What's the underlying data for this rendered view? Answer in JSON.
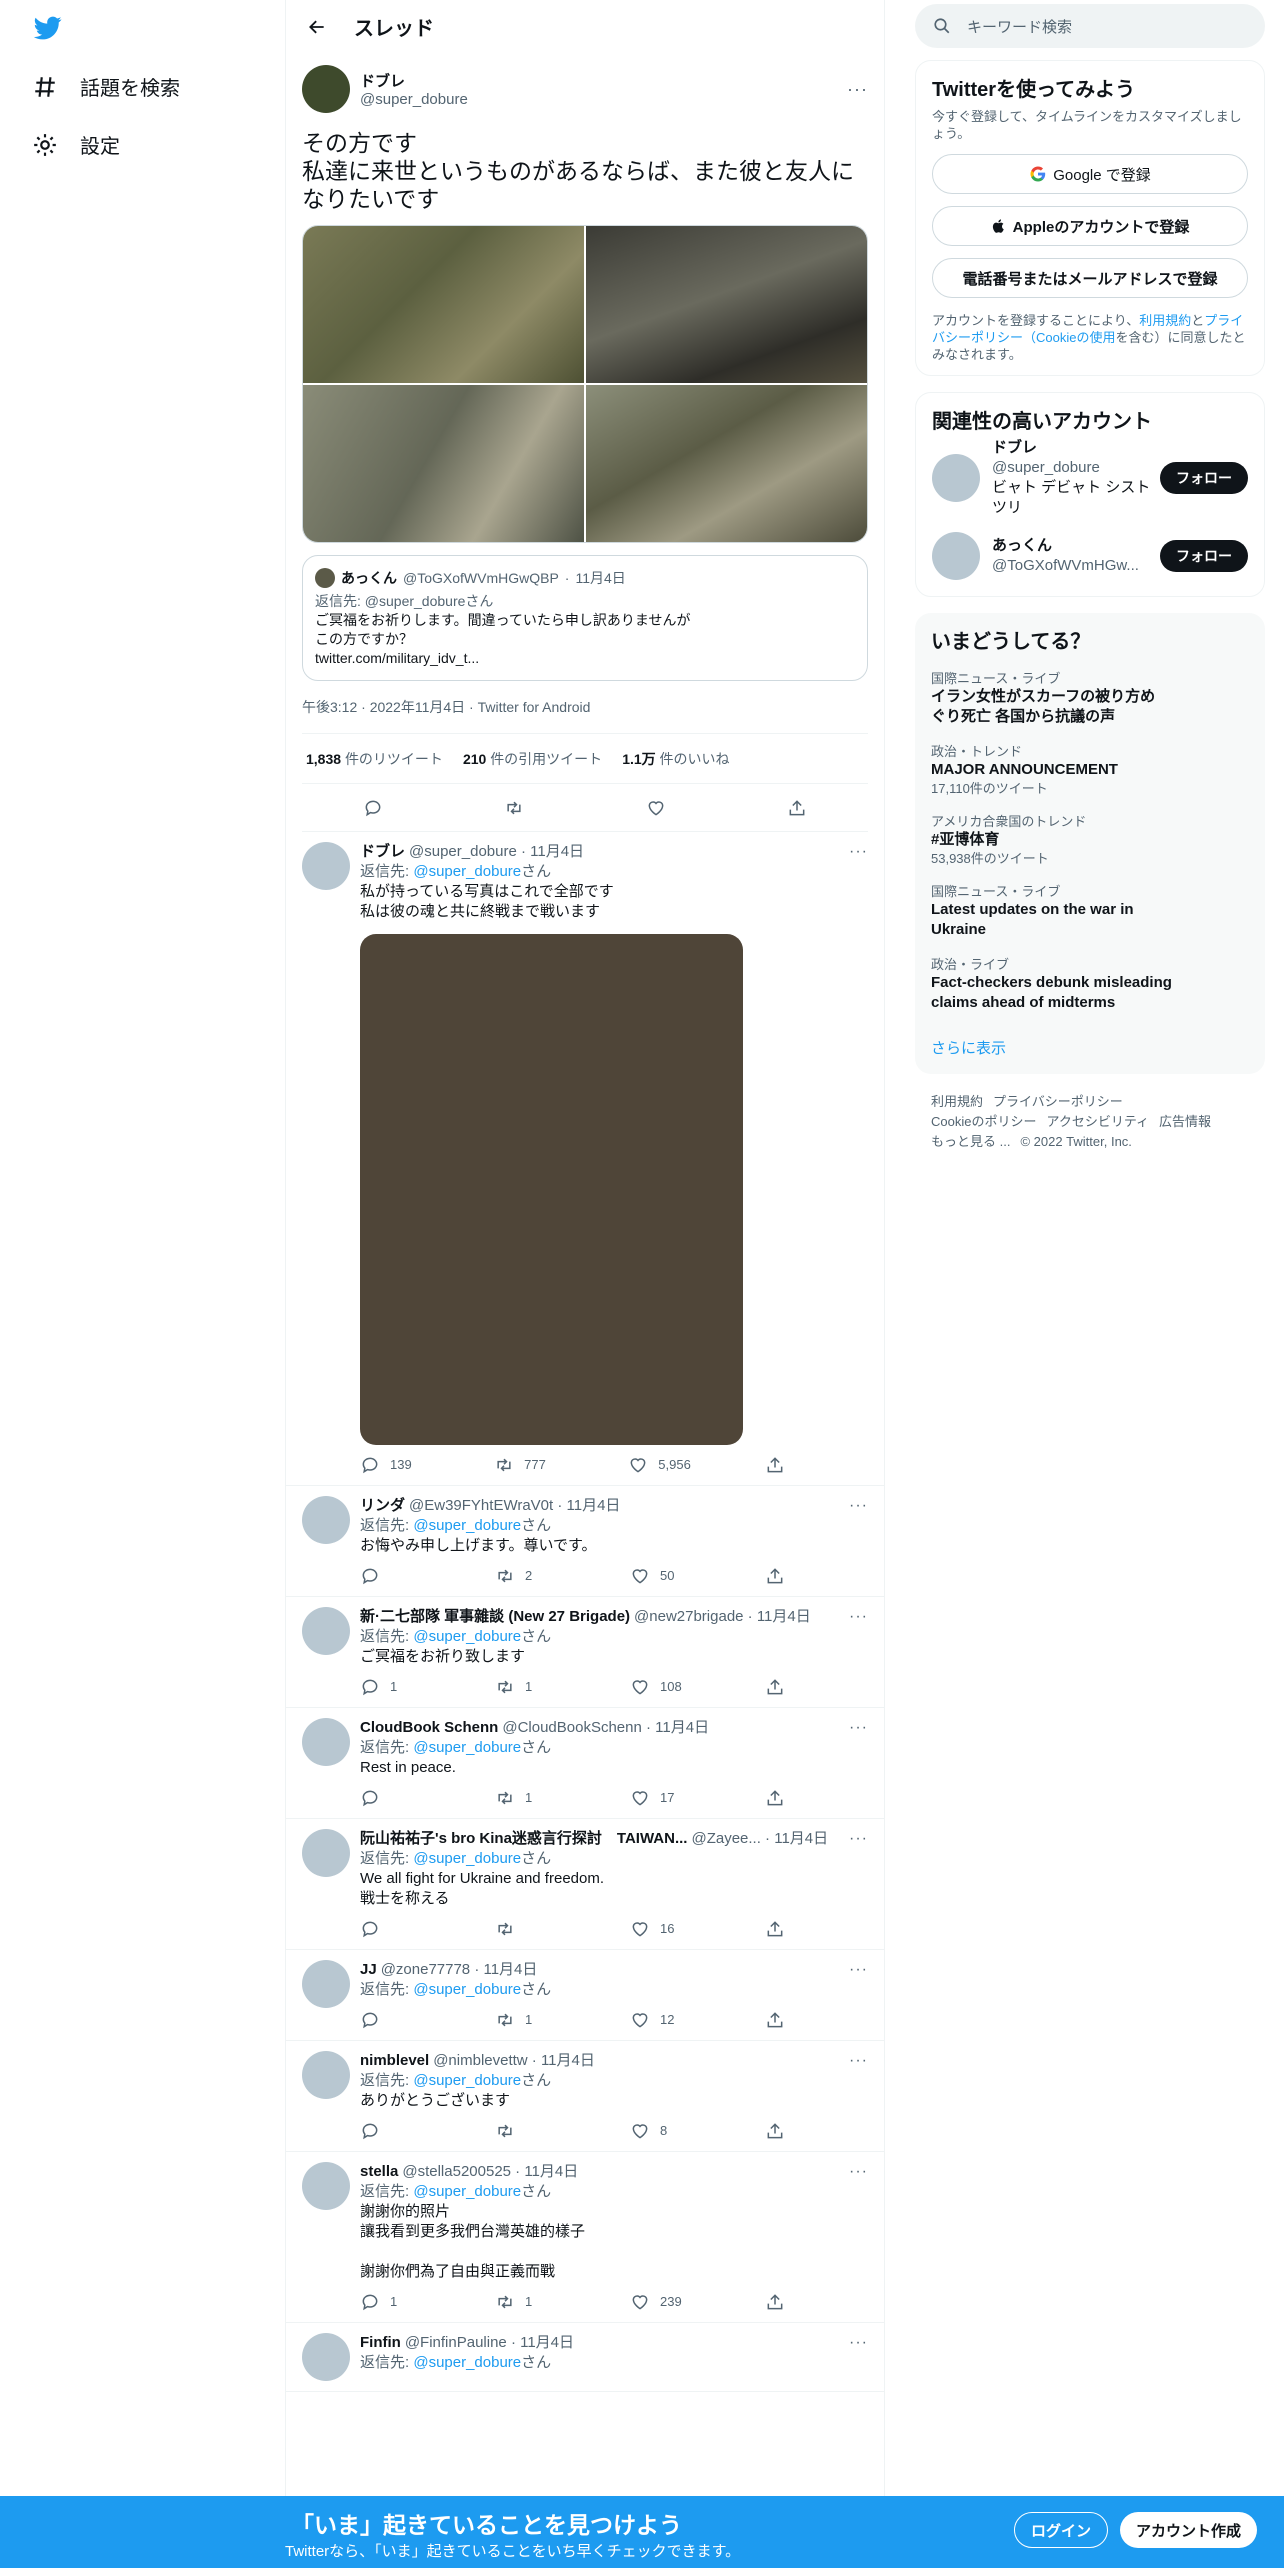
{
  "nav": {
    "explore_label": "話題を検索",
    "settings_label": "設定"
  },
  "header": {
    "title": "スレッド"
  },
  "main_tweet": {
    "name": "ドブレ",
    "handle": "@super_dobure",
    "text": "その方です\n私達に来世というものがあるならば、また彼と友人になりたいです",
    "quote": {
      "name": "あっくん",
      "handle": "@ToGXofWVmHGwQBP",
      "date": "11月4日",
      "reply_prefix": "返信先: @super_dobureさん",
      "text": "ご冥福をお祈りします。間違っていたら申し訳ありませんが\nこの方ですか？\ntwitter.com/military_idv_t..."
    },
    "meta": "午後3:12 · 2022年11月4日 · Twitter for Android",
    "stats": {
      "retweets_count": "1,838",
      "retweets_label": "件のリツイート",
      "quotes_count": "210",
      "quotes_label": "件の引用ツイート",
      "likes_count": "1.1万",
      "likes_label": "件のいいね"
    }
  },
  "replies": [
    {
      "name": "ドブレ",
      "handle": "@super_dobure · 11月4日",
      "reply_to_label": "返信先:",
      "reply_to_handle": "@super_dobure",
      "reply_to_suffix": "さん",
      "text": "私が持っている写真はこれで全部です\n私は彼の魂と共に終戦まで戦います",
      "replies": "139",
      "retweets": "777",
      "likes": "5,956"
    },
    {
      "name": "リンダ",
      "handle": "@Ew39FYhtEWraV0t · 11月4日",
      "reply_to_label": "返信先:",
      "reply_to_handle": "@super_dobure",
      "reply_to_suffix": "さん",
      "text": "お悔やみ申し上げます。尊いです。",
      "replies": "",
      "retweets": "2",
      "likes": "50"
    },
    {
      "name": "新·二七部隊 軍事雜談 (New 27 Brigade)",
      "handle": "@new27brigade · 11月4日",
      "reply_to_label": "返信先:",
      "reply_to_handle": "@super_dobure",
      "reply_to_suffix": "さん",
      "text": "ご冥福をお祈り致します",
      "replies": "1",
      "retweets": "1",
      "likes": "108"
    },
    {
      "name": "CloudBook Schenn",
      "handle": "@CloudBookSchenn · 11月4日",
      "reply_to_label": "返信先:",
      "reply_to_handle": "@super_dobure",
      "reply_to_suffix": "さん",
      "text": "Rest in peace.",
      "replies": "",
      "retweets": "1",
      "likes": "17"
    },
    {
      "name": "阮山祐祐子's bro Kina迷惑言行探討　TAIWAN...",
      "handle": "@Zayee... · 11月4日",
      "reply_to_label": "返信先:",
      "reply_to_handle": "@super_dobure",
      "reply_to_suffix": "さん",
      "text": "We all fight for Ukraine and freedom.\n戦士を称える",
      "replies": "",
      "retweets": "",
      "likes": "16"
    },
    {
      "name": "JJ",
      "handle": "@zone77778 · 11月4日",
      "reply_to_label": "返信先:",
      "reply_to_handle": "@super_dobure",
      "reply_to_suffix": "さん",
      "text": "",
      "replies": "",
      "retweets": "1",
      "likes": "12"
    },
    {
      "name": "nimblevel",
      "handle": "@nimblevettw · 11月4日",
      "reply_to_label": "返信先:",
      "reply_to_handle": "@super_dobure",
      "reply_to_suffix": "さん",
      "text": "ありがとうございます",
      "replies": "",
      "retweets": "",
      "likes": "8"
    },
    {
      "name": "stella",
      "handle": "@stella5200525 · 11月4日",
      "reply_to_label": "返信先:",
      "reply_to_handle": "@super_dobure",
      "reply_to_suffix": "さん",
      "text": "謝謝你的照片\n讓我看到更多我們台灣英雄的樣子\n\n謝謝你們為了自由與正義而戰",
      "replies": "1",
      "retweets": "1",
      "likes": "239"
    },
    {
      "name": "Finfin",
      "handle": "@FinfinPauline · 11月4日",
      "reply_to_label": "返信先:",
      "reply_to_handle": "@super_dobure",
      "reply_to_suffix": "さん",
      "text": "",
      "replies": "",
      "retweets": "",
      "likes": ""
    }
  ],
  "sidebar": {
    "search_placeholder": "キーワード検索",
    "signup": {
      "title": "Twitterを使ってみよう",
      "subtitle": "今すぐ登録して、タイムラインをカスタマイズしましょう。",
      "google_label": "Google で登録",
      "apple_label": "Appleのアカウントで登録",
      "phone_label": "電話番号またはメールアドレスで登録",
      "legal_text": "アカウントを登録することにより、",
      "legal_link1": "利用規約",
      "legal_mid": "と",
      "legal_link2": "プライバシーポリシー（Cookieの使用",
      "legal_end": "を含む）に同意したとみなされます。"
    },
    "related": {
      "title": "関連性の高いアカウント",
      "follow_label": "フォロー",
      "accounts": [
        {
          "name": "ドブレ",
          "handle": "@super_dobure",
          "bio": "ビャト デビャト シスト ツリ"
        },
        {
          "name": "あっくん",
          "handle": "@ToGXofWVmHGw...",
          "bio": ""
        }
      ]
    },
    "trends": {
      "title": "いまどうしてる？",
      "items": [
        {
          "context": "国際ニュース・ライブ",
          "topic": "イラン女性がスカーフの被り方め\nぐり死亡 各国から抗議の声",
          "count": ""
        },
        {
          "context": "政治・トレンド",
          "topic": "MAJOR ANNOUNCEMENT",
          "count": "17,110件のツイート"
        },
        {
          "context": "アメリカ合衆国のトレンド",
          "topic": "#亚博体育",
          "count": "53,938件のツイート"
        },
        {
          "context": "国際ニュース・ライブ",
          "topic": "Latest updates on the war in\nUkraine",
          "count": ""
        },
        {
          "context": "政治・ライブ",
          "topic": "Fact-checkers debunk misleading\nclaims ahead of midterms",
          "count": ""
        }
      ],
      "show_more": "さらに表示"
    },
    "footer": {
      "terms": "利用規約",
      "privacy": "プライバシーポリシー",
      "cookie": "Cookieのポリシー",
      "accessibility": "アクセシビリティ",
      "ads": "広告情報",
      "more": "もっと見る ...",
      "copyright": "© 2022 Twitter, Inc."
    }
  },
  "bottom_bar": {
    "headline": "「いま」起きていることを見つけよう",
    "subline": "Twitterなら、「いま」起きていることをいち早くチェックできます。",
    "login_label": "ログイン",
    "signup_label": "アカウント作成"
  },
  "colors": {
    "accent": "#1d9bf0",
    "text": "#0f1419",
    "muted": "#536471",
    "video": "#4f4538"
  }
}
